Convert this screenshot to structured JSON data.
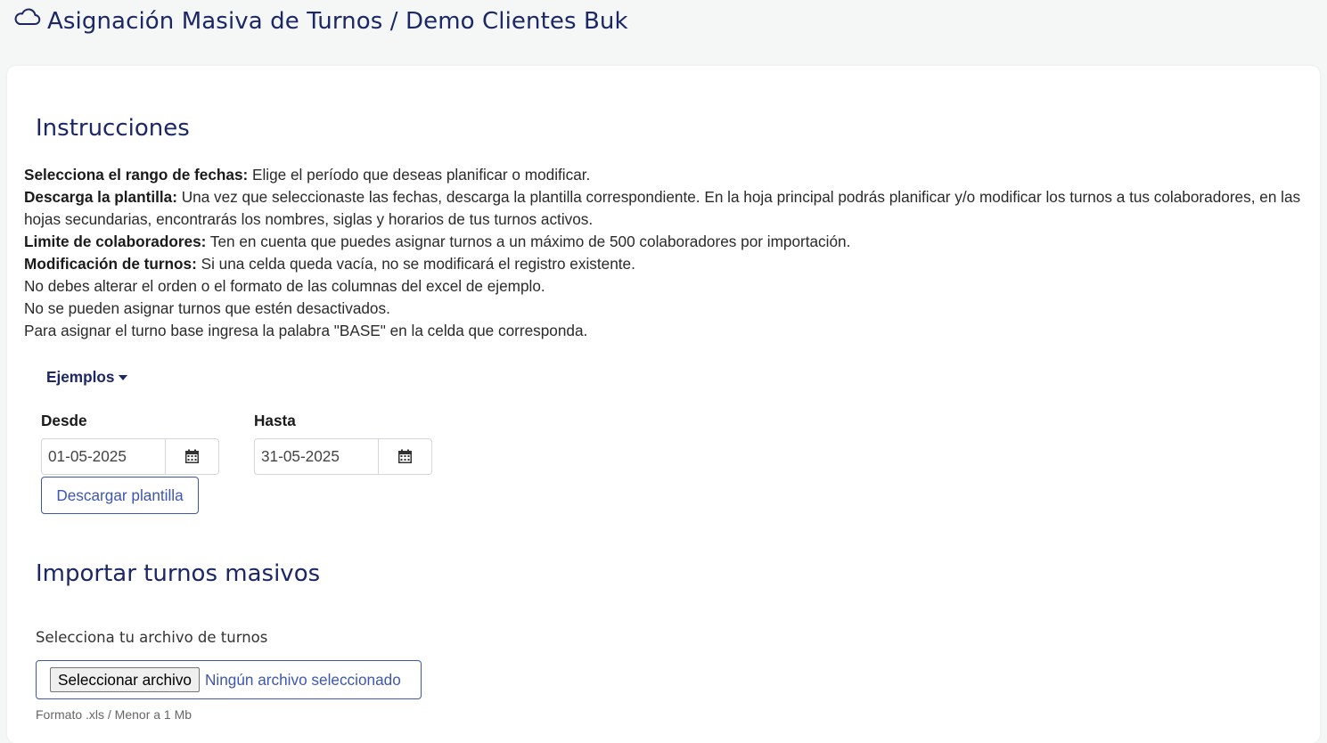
{
  "header": {
    "title": "Asignación Masiva de Turnos / Demo Clientes Buk",
    "icon": "cloud-icon"
  },
  "instructions": {
    "title": "Instrucciones",
    "items": [
      {
        "label": "Selecciona el rango de fechas:",
        "text": " Elige el período que deseas planificar o modificar."
      },
      {
        "label": "Descarga la plantilla:",
        "text": " Una vez que seleccionaste las fechas, descarga la plantilla correspondiente. En la hoja principal podrás planificar y/o modificar los turnos a tus colaboradores, en las hojas secundarias, encontrarás los nombres, siglas y horarios de tus turnos activos."
      },
      {
        "label": "Limite de colaboradores:",
        "text": " Ten en cuenta que puedes asignar turnos a un máximo de 500 colaboradores por importación."
      },
      {
        "label": "Modificación de turnos:",
        "text": " Si una celda queda vacía, no se modificará el registro existente."
      }
    ],
    "notes": [
      "No debes alterar el orden o el formato de las columnas del excel de ejemplo.",
      "No se pueden asignar turnos que estén desactivados.",
      "Para asignar el turno base ingresa la palabra \"BASE\" en la celda que corresponda."
    ]
  },
  "examples": {
    "label": "Ejemplos"
  },
  "date_range": {
    "from_label": "Desde",
    "from_value": "01-05-2025",
    "to_label": "Hasta",
    "to_value": "31-05-2025"
  },
  "download_button": "Descargar plantilla",
  "import": {
    "title": "Importar turnos masivos",
    "file_label": "Selecciona tu archivo de turnos",
    "file_button": "Seleccionar archivo",
    "file_status": "Ningún archivo seleccionado",
    "hint": "Formato .xls / Menor a 1 Mb"
  },
  "colors": {
    "primary": "#1b2766",
    "accent": "#3d56b2",
    "background": "#f4f7f6"
  }
}
